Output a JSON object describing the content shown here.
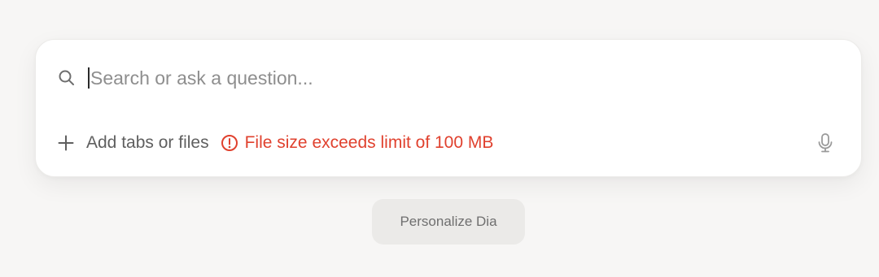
{
  "search": {
    "placeholder": "Search or ask a question...",
    "value": ""
  },
  "composer": {
    "add_label": "Add tabs or files",
    "error_message": "File size exceeds limit of 100 MB"
  },
  "footer": {
    "personalize_label": "Personalize Dia"
  },
  "icons": {
    "search": "search-icon",
    "add": "plus-icon",
    "error": "alert-circle-icon",
    "voice": "microphone-icon"
  },
  "colors": {
    "error": "#e0412e",
    "background": "#f7f6f5",
    "card": "#ffffff",
    "button": "#ebeae8"
  }
}
